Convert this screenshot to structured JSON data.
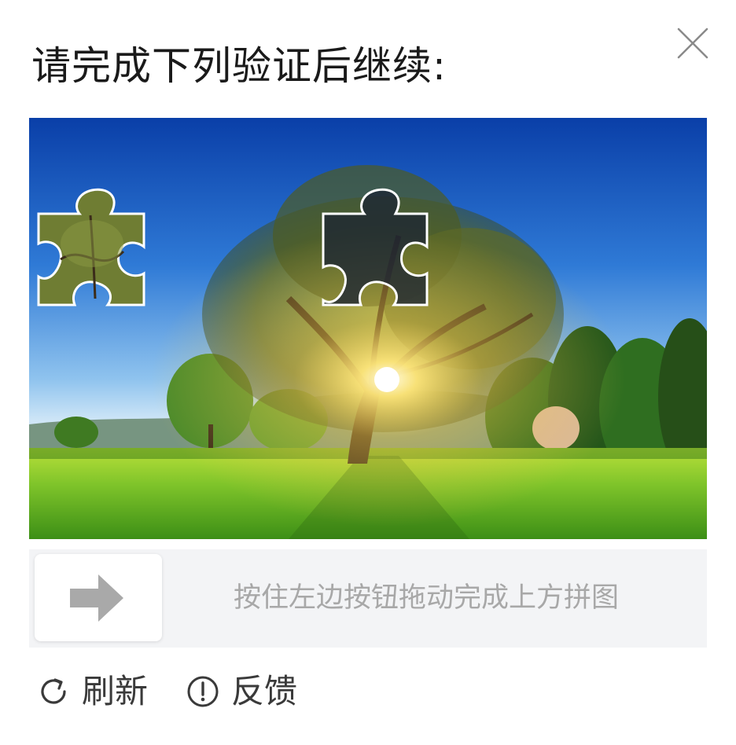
{
  "dialog": {
    "title": "请完成下列验证后继续:",
    "close_icon": "close-icon"
  },
  "puzzle": {
    "background_image": "sunlit tree in green meadow under blue sky",
    "piece_icon": "puzzle-piece",
    "slot_icon": "puzzle-slot"
  },
  "slider": {
    "hint": "按住左边按钮拖动完成上方拼图",
    "handle_icon": "arrow-right-icon"
  },
  "footer": {
    "refresh_label": "刷新",
    "refresh_icon": "refresh-icon",
    "feedback_label": "反馈",
    "feedback_icon": "alert-circle-icon"
  },
  "colors": {
    "title_text": "#1a1a1a",
    "hint_text": "#a8a8a8",
    "track_bg": "#f3f4f6",
    "arrow": "#a9a9a9",
    "footer_text": "#3a3a3a"
  }
}
